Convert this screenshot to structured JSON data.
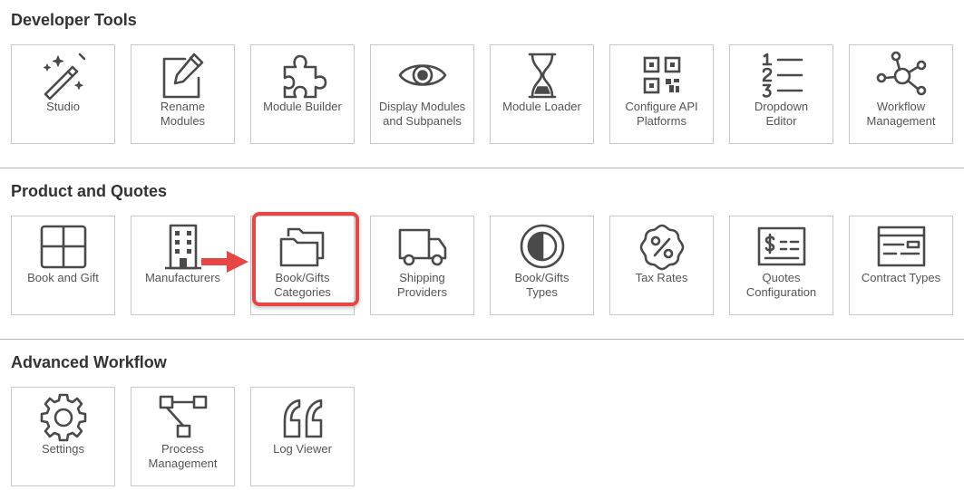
{
  "sections": [
    {
      "title": "Developer Tools",
      "tiles": [
        {
          "label": "Studio",
          "icon": "magic-wand-icon"
        },
        {
          "label": "Rename\nModules",
          "icon": "pencil-square-icon"
        },
        {
          "label": "Module Builder",
          "icon": "puzzle-piece-icon"
        },
        {
          "label": "Display Modules\nand Subpanels",
          "icon": "eye-icon"
        },
        {
          "label": "Module Loader",
          "icon": "hourglass-icon"
        },
        {
          "label": "Configure API\nPlatforms",
          "icon": "qr-code-icon"
        },
        {
          "label": "Dropdown\nEditor",
          "icon": "numbered-list-icon"
        },
        {
          "label": "Workflow\nManagement",
          "icon": "network-nodes-icon"
        }
      ]
    },
    {
      "title": "Product and Quotes",
      "tiles": [
        {
          "label": "Book and Gift",
          "icon": "grid-squares-icon"
        },
        {
          "label": "Manufacturers",
          "icon": "building-icon"
        },
        {
          "label": "Book/Gifts\nCategories",
          "icon": "folders-icon"
        },
        {
          "label": "Shipping\nProviders",
          "icon": "truck-icon"
        },
        {
          "label": "Book/Gifts\nTypes",
          "icon": "half-circle-icon"
        },
        {
          "label": "Tax Rates",
          "icon": "percent-badge-icon"
        },
        {
          "label": "Quotes\nConfiguration",
          "icon": "dollar-card-icon"
        },
        {
          "label": "Contract Types",
          "icon": "contract-form-icon"
        }
      ]
    },
    {
      "title": "Advanced Workflow",
      "tiles": [
        {
          "label": "Settings",
          "icon": "gear-icon"
        },
        {
          "label": "Process\nManagement",
          "icon": "process-flow-icon"
        },
        {
          "label": "Log Viewer",
          "icon": "quote-marks-icon"
        }
      ]
    }
  ],
  "colors": {
    "icon_stroke": "#4a4a4a",
    "tile_border": "#c8c8c8",
    "highlight": "#e84545",
    "text": "#555555",
    "title": "#333333"
  }
}
